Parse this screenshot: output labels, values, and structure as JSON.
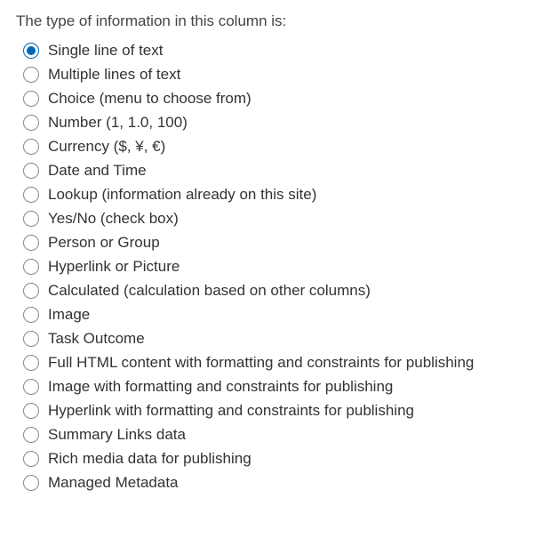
{
  "heading": "The type of information in this column is:",
  "selectedIndex": 0,
  "options": [
    {
      "label": "Single line of text"
    },
    {
      "label": "Multiple lines of text"
    },
    {
      "label": "Choice (menu to choose from)"
    },
    {
      "label": "Number (1, 1.0, 100)"
    },
    {
      "label": "Currency ($, ¥, €)"
    },
    {
      "label": "Date and Time"
    },
    {
      "label": "Lookup (information already on this site)"
    },
    {
      "label": "Yes/No (check box)"
    },
    {
      "label": "Person or Group"
    },
    {
      "label": "Hyperlink or Picture"
    },
    {
      "label": "Calculated (calculation based on other columns)"
    },
    {
      "label": "Image"
    },
    {
      "label": "Task Outcome"
    },
    {
      "label": "Full HTML content with formatting and constraints for publishing"
    },
    {
      "label": "Image with formatting and constraints for publishing"
    },
    {
      "label": "Hyperlink with formatting and constraints for publishing"
    },
    {
      "label": "Summary Links data"
    },
    {
      "label": "Rich media data for publishing"
    },
    {
      "label": "Managed Metadata"
    }
  ]
}
